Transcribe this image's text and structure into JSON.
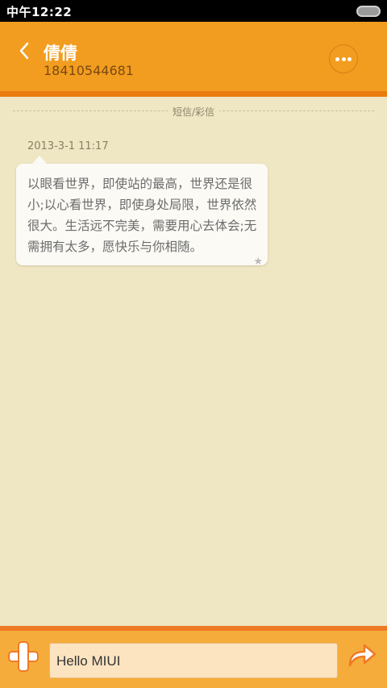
{
  "status_bar": {
    "time": "中午12:22"
  },
  "header": {
    "contact_name": "倩倩",
    "contact_number": "18410544681"
  },
  "divider": {
    "label": "短信/彩信"
  },
  "message": {
    "timestamp": "2013-3-1 11:17",
    "text": "以眼看世界，即使站的最高，世界还是很小;以心看世界，即使身处局限，世界依然很大。生活远不完美，需要用心去体会;无需拥有太多，愿快乐与你相随。",
    "star": "★"
  },
  "compose": {
    "input_value": "Hello MIUI"
  },
  "icons": {
    "back": "chevron-left-icon",
    "more": "more-dots-icon",
    "add": "plus-icon",
    "send": "send-arrow-icon",
    "battery": "battery-icon",
    "star": "star-icon"
  },
  "colors": {
    "header": "#f29d1f",
    "header_stripe": "#ea7c0f",
    "background": "#efe6c4",
    "compose_bar": "#f6ac3b",
    "accent": "#ee7a26"
  }
}
